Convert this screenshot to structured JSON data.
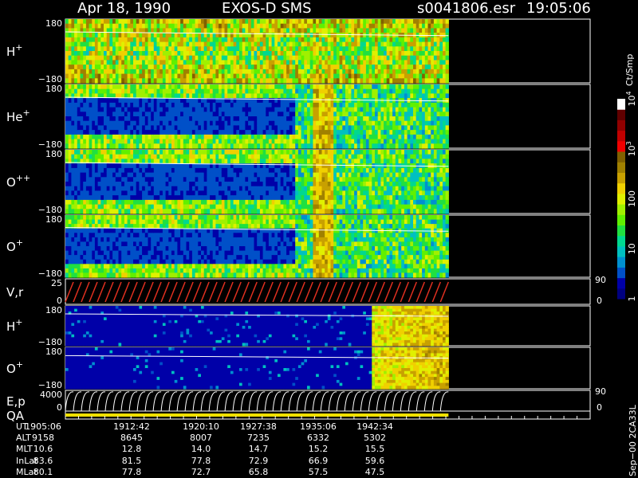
{
  "header": {
    "date": "Apr 18, 1990",
    "instrument": "EXOS-D SMS",
    "file": "s0041806.esr",
    "time": "19:05:06"
  },
  "chart_data": {
    "type": "heatmap",
    "panels": [
      {
        "id": "h_plus",
        "label": "H",
        "sup": "+",
        "tick_top": "180",
        "tick_bottom": "−180",
        "activity": "high"
      },
      {
        "id": "he_plus",
        "label": "He",
        "sup": "+",
        "tick_top": "180",
        "tick_bottom": "−180",
        "activity": "mid"
      },
      {
        "id": "o_pp",
        "label": "O",
        "sup": "++",
        "tick_top": "180",
        "tick_bottom": "−180",
        "activity": "mid"
      },
      {
        "id": "o_plus",
        "label": "O",
        "sup": "+",
        "tick_top": "180",
        "tick_bottom": "−180",
        "activity": "mid"
      },
      {
        "id": "vr",
        "label": "V,r",
        "tick_top": "25",
        "tick_bottom": "0",
        "right_top": "90",
        "right_bottom": "0"
      },
      {
        "id": "h_plus2",
        "label": "H",
        "sup": "+",
        "tick_top": "180",
        "tick_bottom": "−180",
        "activity": "low"
      },
      {
        "id": "o_plus2",
        "label": "O",
        "sup": "+",
        "tick_top": "180",
        "tick_bottom": "−180",
        "activity": "low"
      },
      {
        "id": "ep",
        "label": "E,p",
        "tick_top": "4000",
        "tick_bottom": "0",
        "right_top": "90",
        "right_bottom": "0"
      },
      {
        "id": "qa",
        "label": "QA"
      }
    ],
    "colorbar": {
      "title": "Ct/Smp",
      "scale": "log",
      "range": [
        1,
        10000
      ],
      "tick_labels": [
        "1",
        "10",
        "100",
        "10",
        "10"
      ],
      "tick_exponents": [
        "",
        "",
        "",
        "3",
        "4"
      ],
      "colors": [
        "#000080",
        "#0000a8",
        "#0050c8",
        "#0090d0",
        "#00c0c0",
        "#00d890",
        "#20e040",
        "#60f000",
        "#a0f000",
        "#e0f000",
        "#f0d000",
        "#c8a000",
        "#a08000",
        "#806000",
        "#f00000",
        "#c00000",
        "#900000",
        "#600000",
        "#ffffff"
      ]
    },
    "ephemeris": {
      "rows": [
        "UT",
        "ALT",
        "MLT",
        "InLat",
        "MLat"
      ],
      "columns": [
        [
          "1905:06",
          "9158",
          "10.6",
          "83.6",
          "80.1"
        ],
        [
          "1912:42",
          "8645",
          "12.8",
          "81.5",
          "77.8"
        ],
        [
          "1920:10",
          "8007",
          "14.0",
          "77.8",
          "72.7"
        ],
        [
          "1927:38",
          "7235",
          "14.7",
          "72.9",
          "65.8"
        ],
        [
          "1935:06",
          "6332",
          "15.2",
          "66.9",
          "57.5"
        ],
        [
          "1942:34",
          "5302",
          "15.5",
          "59.6",
          "47.5"
        ]
      ]
    },
    "footer_note": "Sep−00  2CA33L",
    "data_end_fraction": 0.73
  }
}
